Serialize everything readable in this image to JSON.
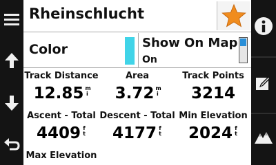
{
  "header": {
    "title": "Rheinschlucht"
  },
  "settings": {
    "color_label": "Color",
    "color_value_hex": "#40d4e8",
    "show_on_map_label": "Show On Map",
    "show_on_map_value": "On"
  },
  "stats": [
    {
      "label": "Track Distance",
      "value": "12.85",
      "unit": [
        "m",
        "i"
      ]
    },
    {
      "label": "Area",
      "value": "3.72",
      "unit": [
        "m",
        "i"
      ]
    },
    {
      "label": "Track Points",
      "value": "3214",
      "unit": []
    },
    {
      "label": "Ascent - Total",
      "value": "4409",
      "unit": [
        "f",
        "t"
      ]
    },
    {
      "label": "Descent - Total",
      "value": "4177",
      "unit": [
        "f",
        "t"
      ]
    },
    {
      "label": "Min Elevation",
      "value": "2024",
      "unit": [
        "f",
        "t"
      ]
    },
    {
      "label": "Max Elevation",
      "value": "",
      "unit": []
    }
  ],
  "icons": {
    "left_rail": [
      "menu-icon",
      "arrow-up-icon",
      "arrow-down-icon",
      "back-icon"
    ],
    "right_rail": [
      "info-icon",
      "edit-track-icon",
      "elevation-plot-icon"
    ],
    "favorite": "star-icon"
  },
  "colors": {
    "favorite_star": "#f08c1e",
    "accent_blue": "#2a8fd8"
  }
}
